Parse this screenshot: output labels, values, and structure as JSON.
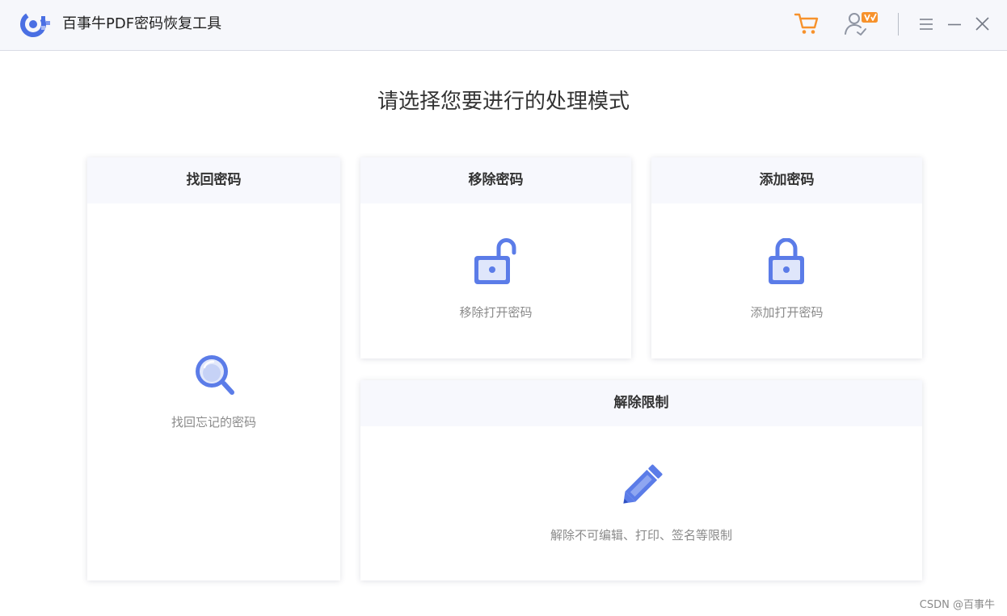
{
  "app": {
    "title": "百事牛PDF密码恢复工具",
    "logo_icon": "logo-icon",
    "accent": "#5b7ce8",
    "orange": "#f7922c"
  },
  "window_controls": {
    "cart_icon": "cart-icon",
    "account_icon": "user-vip-icon",
    "menu_icon": "menu-icon",
    "minimize_icon": "minimize-icon",
    "close_icon": "close-icon"
  },
  "main": {
    "heading": "请选择您要进行的处理模式"
  },
  "cards": {
    "recover": {
      "title": "找回密码",
      "desc": "找回忘记的密码",
      "icon": "magnifier-icon"
    },
    "remove": {
      "title": "移除密码",
      "desc": "移除打开密码",
      "icon": "unlock-icon"
    },
    "add": {
      "title": "添加密码",
      "desc": "添加打开密码",
      "icon": "lock-icon"
    },
    "unrestrict": {
      "title": "解除限制",
      "desc": "解除不可编辑、打印、签名等限制",
      "icon": "pencil-icon"
    }
  },
  "watermark": "CSDN @百事牛"
}
